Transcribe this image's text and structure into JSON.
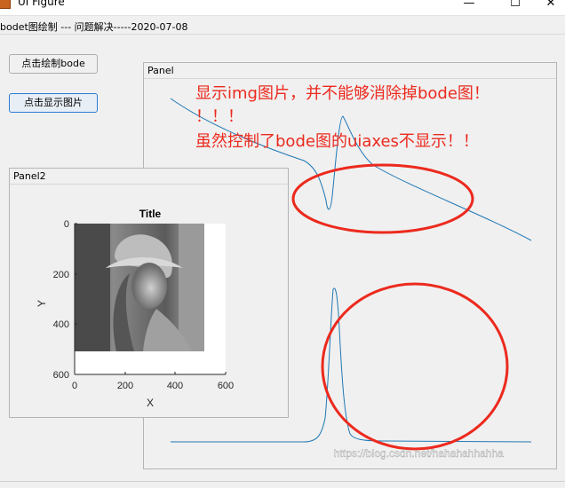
{
  "window": {
    "title": "UI Figure",
    "minimize_glyph": "—",
    "maximize_glyph": "☐",
    "close_glyph": "✕"
  },
  "header": {
    "text": "bodet图绘制  ---  问题解决-----2020-07-08"
  },
  "buttons": {
    "draw_bode": "点击绘制bode",
    "show_image": "点击显示图片"
  },
  "panel_main": {
    "title": "Panel"
  },
  "panel2": {
    "title": "Panel2"
  },
  "annotation": {
    "line1": "显示img图片，并不能够消除掉bode图！",
    "line2": "！！！",
    "line3": "虽然控制了bode图的uiaxes不显示！！",
    "color": "#ec2a1e"
  },
  "axes": {
    "title": "Title",
    "xlabel": "X",
    "ylabel": "Y",
    "xticks": [
      "0",
      "200",
      "400",
      "600"
    ],
    "yticks": [
      "0",
      "200",
      "400",
      "600"
    ],
    "image_name": "lena-grayscale-image"
  },
  "bode_color": "#1f77b4",
  "watermark": "https://blog.csdn.net/hahahahhahha"
}
